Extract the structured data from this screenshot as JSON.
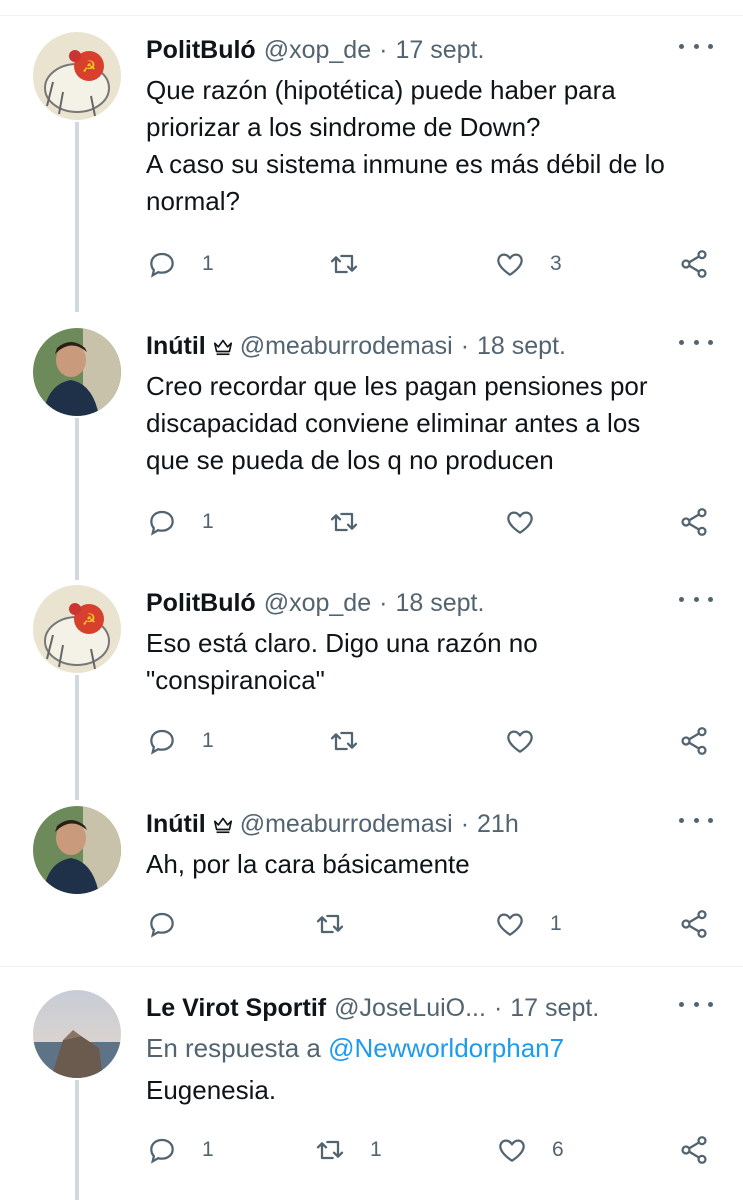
{
  "tweets": [
    {
      "name": "PolitBuló",
      "handle": "@xop_de",
      "time": "17 sept.",
      "lines": [
        "Que razón (hipotética) puede haber para",
        "priorizar a los sindrome de Down?",
        "A caso su sistema inmune es más débil de lo",
        "normal?"
      ],
      "replies": "1",
      "retweets": "",
      "likes": "3"
    },
    {
      "name": "Inútil",
      "handle": "@meaburrodemasi",
      "time": "18 sept.",
      "lines": [
        "Creo recordar que les pagan pensiones por",
        "discapacidad conviene eliminar antes a los",
        "que se pueda de los q no producen"
      ],
      "replies": "1",
      "retweets": "",
      "likes": ""
    },
    {
      "name": "PolitBuló",
      "handle": "@xop_de",
      "time": "18 sept.",
      "lines": [
        "Eso está claro. Digo una razón no",
        "\"conspiranoica\""
      ],
      "replies": "1",
      "retweets": "",
      "likes": ""
    },
    {
      "name": "Inútil",
      "handle": "@meaburrodemasi",
      "time": "21h",
      "lines": [
        "Ah, por la cara básicamente"
      ],
      "replies": "",
      "retweets": "",
      "likes": "1"
    },
    {
      "name": "Le Virot Sportif",
      "handle": "@JoseLuiO...",
      "time": "17 sept.",
      "reply_prefix": "En respuesta a",
      "reply_mention": "@Newworldorphan7",
      "lines": [
        "Eugenesia."
      ],
      "replies": "1",
      "retweets": "1",
      "likes": "6"
    }
  ],
  "icons": {
    "reply": "reply-icon",
    "retweet": "retweet-icon",
    "like": "heart-icon",
    "share": "share-icon",
    "more": "more-icon",
    "badge": "crown-icon"
  },
  "colors": {
    "text": "#0f1419",
    "secondary": "#536471",
    "link": "#1d9bf0",
    "thread_line": "#cfd9de"
  }
}
